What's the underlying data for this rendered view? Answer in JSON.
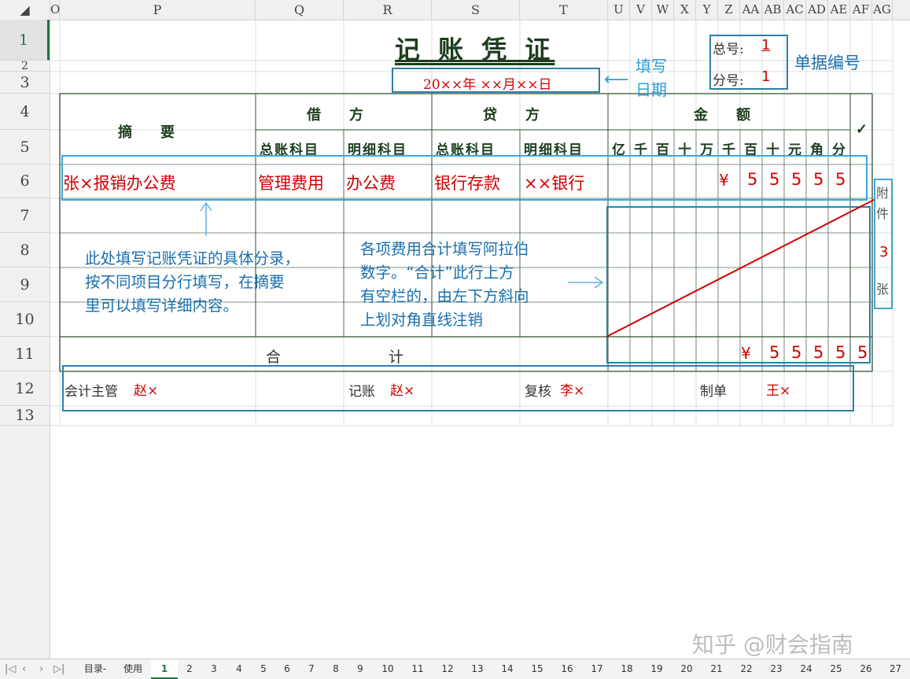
{
  "sheet": {
    "columns": [
      "O",
      "P",
      "Q",
      "R",
      "S",
      "T",
      "U",
      "V",
      "W",
      "X",
      "Y",
      "Z",
      "AA",
      "AB",
      "AC",
      "AD",
      "AE",
      "AF",
      "AG"
    ],
    "rows": [
      "1",
      "2",
      "3",
      "4",
      "5",
      "6",
      "7",
      "8",
      "9",
      "10",
      "11",
      "12",
      "13"
    ],
    "tabs": [
      "目录-",
      "使用",
      "1",
      "2",
      "3",
      "4",
      "5",
      "6",
      "7",
      "8",
      "9",
      "10",
      "11",
      "12",
      "13",
      "14",
      "15",
      "16",
      "17",
      "18",
      "19",
      "20",
      "21",
      "22",
      "23",
      "24",
      "25",
      "26",
      "27"
    ],
    "active_tab": "1"
  },
  "voucher": {
    "title": "记 账 凭 证",
    "total_no_label": "总号:",
    "total_no": "1",
    "sub_no_label": "分号:",
    "sub_no": "1",
    "date": "20××年 ××月××日",
    "header": {
      "summary": "摘　　要",
      "debit": "借　　方",
      "credit": "贷　　方",
      "amount": "金　　额",
      "check": "✓",
      "debit_general": "总账科目",
      "debit_detail": "明细科目",
      "credit_general": "总账科目",
      "credit_detail": "明细科目",
      "digits": [
        "亿",
        "千",
        "百",
        "十",
        "万",
        "千",
        "百",
        "十",
        "元",
        "角",
        "分"
      ]
    },
    "entry": {
      "summary": "张×报销办公费",
      "debit_general": "管理费用",
      "debit_detail": "办公费",
      "credit_general": "银行存款",
      "credit_detail": "××银行",
      "currency": "¥",
      "digits": [
        "5",
        "5",
        "5",
        "5",
        "5"
      ]
    },
    "total_row": {
      "label_left": "合",
      "label_right": "计",
      "currency": "¥",
      "digits": [
        "5",
        "5",
        "5",
        "5",
        "5"
      ]
    },
    "attachment": {
      "top": "附",
      "mid": "件",
      "count": "3",
      "unit": "张"
    },
    "signatures": {
      "supervisor": "会计主管",
      "supervisor_name": "赵×",
      "bookkeeper": "记账",
      "bookkeeper_name": "赵×",
      "reviewer": "复核",
      "reviewer_name": "李×",
      "maker": "制单",
      "maker_name": "王×"
    }
  },
  "annotations": {
    "fill_date": [
      "填写",
      "日期"
    ],
    "doc_number": "单据编号",
    "entry_note": [
      "此处填写记账凭证的具体分录，",
      "按不同项目分行填写，在摘要",
      "里可以填写详细内容。"
    ],
    "sum_note": [
      "各项费用合计填写阿拉伯",
      "数字。“合计”此行上方",
      "有空栏的，由左下方斜向",
      "上划对角直线注销"
    ]
  },
  "watermark": "知乎 @财会指南",
  "colors": {
    "red": "#d00000",
    "cyan": "#2a9fd6",
    "blue": "#1a6fae",
    "box": "#2d7fa8",
    "grid": "#2f4f2f"
  }
}
